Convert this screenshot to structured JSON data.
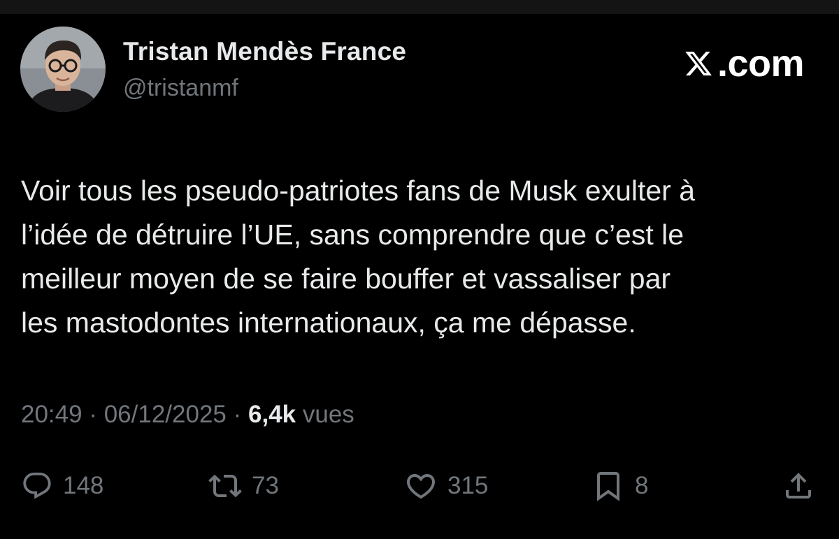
{
  "author": {
    "display_name": "Tristan Mendès France",
    "handle": "@tristanmf"
  },
  "brand": {
    "text": ".com",
    "icon": "x-logo-icon"
  },
  "tweet": {
    "text": "Voir tous les pseudo-patriotes fans de Musk exulter à\nl’idée de détruire l’UE, sans comprendre que c’est le\nmeilleur moyen de se faire bouffer et vassaliser par\nles mastodontes internationaux, ça me dépasse."
  },
  "meta": {
    "time": "20:49",
    "separator": "·",
    "date": "06/12/2025",
    "views_count": "6,4k",
    "views_label": "vues"
  },
  "actions": {
    "replies": {
      "icon": "reply-icon",
      "count": "148"
    },
    "reposts": {
      "icon": "repost-icon",
      "count": "73"
    },
    "likes": {
      "icon": "heart-icon",
      "count": "315"
    },
    "bookmarks": {
      "icon": "bookmark-icon",
      "count": "8"
    },
    "share": {
      "icon": "share-icon"
    }
  },
  "colors": {
    "background": "#000000",
    "text_primary": "#e7e9ea",
    "text_secondary": "#71767b"
  }
}
